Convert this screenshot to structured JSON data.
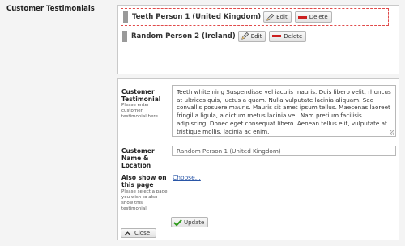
{
  "field_label": "Customer Testimonials",
  "list": {
    "items": [
      {
        "title": "Teeth Person 1 (United Kingdom)",
        "edit_label": "Edit",
        "delete_label": "Delete"
      },
      {
        "title": "Random Person 2 (Ireland)",
        "edit_label": "Edit",
        "delete_label": "Delete"
      }
    ]
  },
  "form": {
    "testimonial_label": "Customer Testimonial",
    "testimonial_help": "Please enter customer testimonial here.",
    "testimonial_value": "Teeth whiteining Suspendisse vel iaculis mauris. Duis libero velit, rhoncus at ultrices quis, luctus a quam. Nulla vulputate lacinia aliquam. Sed convallis posuere mauris. Mauris sit amet ipsum tellus. Maecenas laoreet fringilla ligula, a dictum metus lacinia vel. Nam pretium facilisis adipiscing. Donec eget consequat libero. Aenean tellus elit, vulputate at tristique mollis, lacinia ac enim.",
    "name_label": "Customer Name & Location",
    "name_value": "Random Person 1 (United Kingdom)",
    "also_show_label": "Also show on this page",
    "also_show_help": "Please select a page you wish to also show this testimonial.",
    "choose_link": "Choose...",
    "update_label": "Update",
    "close_label": "Close"
  },
  "colors": {
    "selection_border": "#e04a4a",
    "delete_icon": "#cc1f1f",
    "update_check": "#2e9a1c",
    "link": "#2a56a7"
  }
}
